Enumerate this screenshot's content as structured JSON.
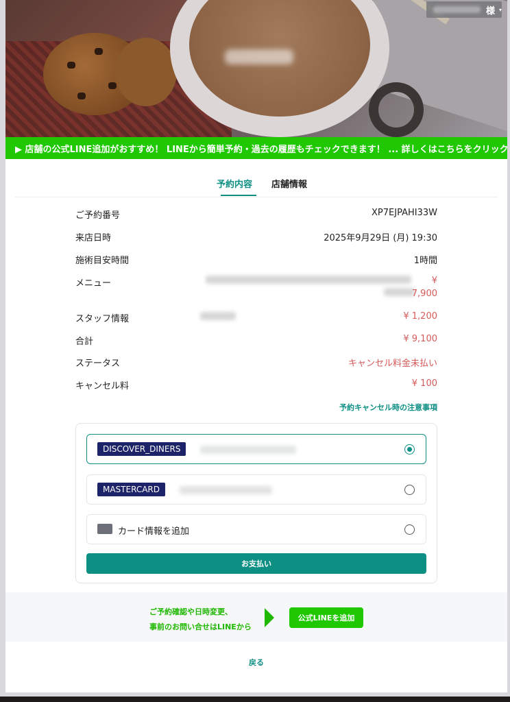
{
  "header": {
    "honorific": "様",
    "caret": "▾"
  },
  "line_banner": {
    "text": "▶ 店舗の公式LINE追加がおすすめ！ LINEから簡単予約・過去の履歴もチェックできます！ ... 詳しくはこちらをクリック"
  },
  "tabs": [
    {
      "label": "予約内容",
      "active": true
    },
    {
      "label": "店舗情報",
      "active": false
    }
  ],
  "details": {
    "reservation_number": {
      "label": "ご予約番号",
      "value": "XP7EJPAHI33W"
    },
    "visit_datetime": {
      "label": "来店日時",
      "value": "2025年9月29日 (月) 19:30"
    },
    "duration": {
      "label": "施術目安時間",
      "value": "1時間"
    },
    "menu": {
      "label": "メニュー",
      "currency": "¥",
      "value": "7,900"
    },
    "staff": {
      "label": "スタッフ情報",
      "value": "¥ 1,200"
    },
    "total": {
      "label": "合計",
      "value": "¥ 9,100"
    },
    "status": {
      "label": "ステータス",
      "value": "キャンセル料金未払い"
    },
    "cancel_fee": {
      "label": "キャンセル料",
      "value": "¥ 100"
    }
  },
  "cancel_notice_link": "予約キャンセル時の注意事項",
  "payment": {
    "methods": [
      {
        "brand": "DISCOVER_DINERS",
        "selected": true
      },
      {
        "brand": "MASTERCARD",
        "selected": false
      }
    ],
    "add_card_label": "カード情報を追加",
    "pay_button": "お支払い"
  },
  "line_footer": {
    "text_line1": "ご予約確認や日時変更、",
    "text_line2": "事前のお問い合せはLINEから",
    "button": "公式LINEを追加"
  },
  "back_link": "戻る",
  "colors": {
    "accent": "#0d8f84",
    "line_green": "#1fc800",
    "price_red": "#d65a5a",
    "card_brand_bg": "#1c2369"
  }
}
